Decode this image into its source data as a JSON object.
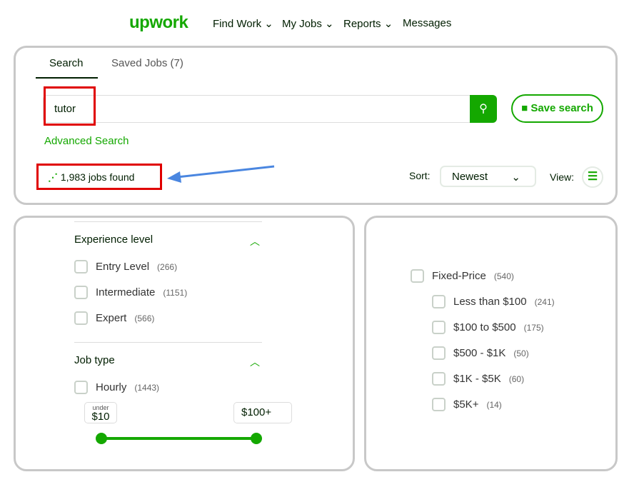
{
  "header": {
    "logo": "upwork",
    "nav": [
      {
        "label": "Find Work"
      },
      {
        "label": "My Jobs"
      },
      {
        "label": "Reports"
      },
      {
        "label": "Messages"
      }
    ]
  },
  "search": {
    "tabs": [
      {
        "label": "Search"
      },
      {
        "label": "Saved Jobs (7)"
      }
    ],
    "query": "tutor",
    "save_label": "Save search",
    "advanced": "Advanced Search",
    "count": "1,983",
    "count_suffix": "jobs found",
    "sort_label": "Sort:",
    "sort_value": "Newest",
    "view_label": "View:"
  },
  "filters": {
    "experience": {
      "title": "Experience level",
      "options": [
        {
          "label": "Entry Level",
          "count": "(266)"
        },
        {
          "label": "Intermediate",
          "count": "(1151)"
        },
        {
          "label": "Expert",
          "count": "(566)"
        }
      ]
    },
    "job_type": {
      "title": "Job type",
      "hourly": {
        "label": "Hourly",
        "count": "(1443)"
      },
      "min_small": "under",
      "min": "$10",
      "max": "$100+"
    },
    "fixed": {
      "label": "Fixed-Price",
      "count": "(540)",
      "options": [
        {
          "label": "Less than $100",
          "count": "(241)"
        },
        {
          "label": "$100 to $500",
          "count": "(175)"
        },
        {
          "label": "$500 - $1K",
          "count": "(50)"
        },
        {
          "label": "$1K - $5K",
          "count": "(60)"
        },
        {
          "label": "$5K+",
          "count": "(14)"
        }
      ]
    }
  },
  "colors": {
    "brand": "#14a800",
    "highlight": "#e00000",
    "arrow": "#4a86e0"
  }
}
